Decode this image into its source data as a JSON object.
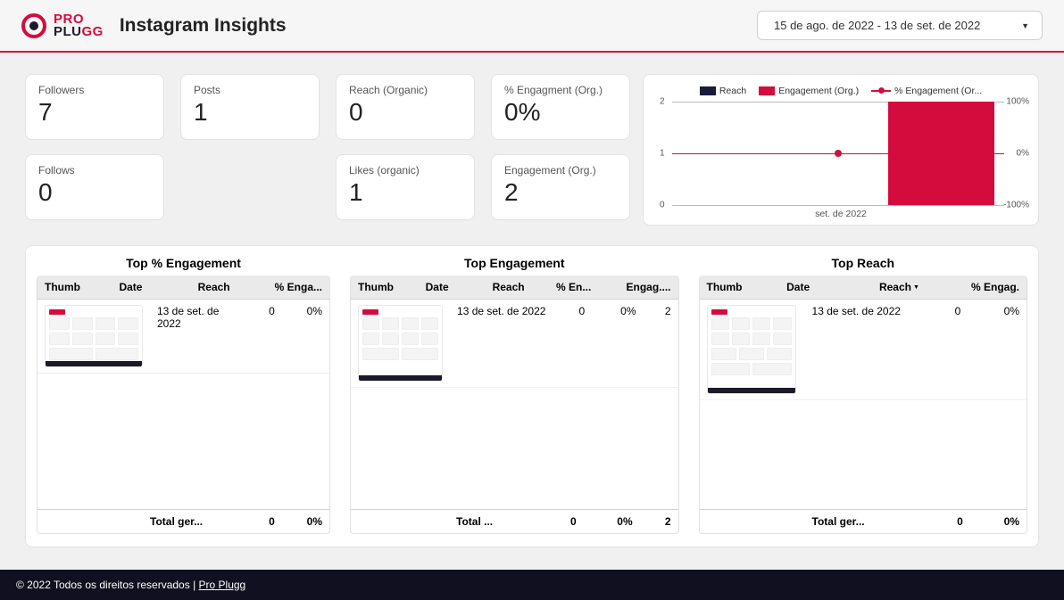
{
  "brand": {
    "line1": "PRO",
    "line2_a": "PLU",
    "line2_b": "GG"
  },
  "page_title": "Instagram Insights",
  "date_range": "15 de ago. de 2022 - 13 de set. de 2022",
  "kpis": {
    "followers": {
      "label": "Followers",
      "value": "7"
    },
    "posts": {
      "label": "Posts",
      "value": "1"
    },
    "reach_org": {
      "label": "Reach (Organic)",
      "value": "0"
    },
    "pct_eng_org": {
      "label": "% Engagment (Org.)",
      "value": "0%"
    },
    "follows": {
      "label": "Follows",
      "value": "0"
    },
    "likes_org": {
      "label": "Likes (organic)",
      "value": "1"
    },
    "eng_org": {
      "label": "Engagement (Org.)",
      "value": "2"
    }
  },
  "chart_data": {
    "type": "bar+line",
    "legend": [
      "Reach",
      "Engagement (Org.)",
      "% Engagement (Or..."
    ],
    "categories": [
      "set. de 2022"
    ],
    "y_left": {
      "ticks": [
        0,
        1,
        2
      ]
    },
    "y_right": {
      "ticks": [
        "-100%",
        "0%",
        "100%"
      ]
    },
    "series": [
      {
        "name": "Reach",
        "type": "bar",
        "color": "#1a1a3a",
        "values": [
          0
        ]
      },
      {
        "name": "Engagement (Org.)",
        "type": "bar",
        "color": "#d40c3e",
        "values": [
          2
        ]
      },
      {
        "name": "% Engagement (Org.)",
        "type": "line",
        "color": "#d40c3e",
        "values": [
          0
        ]
      }
    ]
  },
  "tables": {
    "top_pct_eng": {
      "title": "Top % Engagement",
      "headers": [
        "Thumb",
        "Date",
        "Reach",
        "% Enga..."
      ],
      "rows": [
        {
          "date": "13 de set. de 2022",
          "reach": "0",
          "pct_eng": "0%"
        }
      ],
      "totals": {
        "label": "Total ger...",
        "reach": "0",
        "pct_eng": "0%"
      }
    },
    "top_eng": {
      "title": "Top Engagement",
      "headers": [
        "Thumb",
        "Date",
        "Reach",
        "% En...",
        "Engag...."
      ],
      "rows": [
        {
          "date": "13 de set. de 2022",
          "reach": "0",
          "pct_eng": "0%",
          "eng": "2"
        }
      ],
      "totals": {
        "label": "Total ...",
        "reach": "0",
        "pct_eng": "0%",
        "eng": "2"
      }
    },
    "top_reach": {
      "title": "Top Reach",
      "headers": [
        "Thumb",
        "Date",
        "Reach",
        "% Engag."
      ],
      "sort_indicator": "▼",
      "rows": [
        {
          "date": "13 de set. de 2022",
          "reach": "0",
          "pct_eng": "0%"
        }
      ],
      "totals": {
        "label": "Total ger...",
        "reach": "0",
        "pct_eng": "0%"
      }
    }
  },
  "footer": {
    "text": "© 2022 Todos os direitos reservados | ",
    "link": "Pro Plugg"
  }
}
